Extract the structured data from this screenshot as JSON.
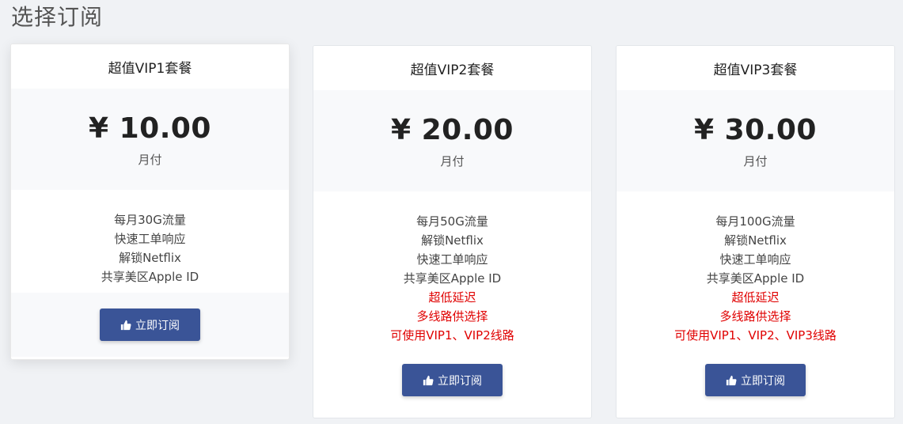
{
  "page": {
    "title": "选择订阅"
  },
  "plans": [
    {
      "name": "超值VIP1套餐",
      "price": "¥ 10.00",
      "period": "月付",
      "features": [
        "每月30G流量",
        "快速工单响应",
        "解锁Netflix",
        "共享美区Apple ID"
      ],
      "highlights": [],
      "button_label": "立即订阅",
      "button_icon": "thumbs-up-icon"
    },
    {
      "name": "超值VIP2套餐",
      "price": "¥ 20.00",
      "period": "月付",
      "features": [
        "每月50G流量",
        "解锁Netflix",
        "快速工单响应",
        "共享美区Apple ID"
      ],
      "highlights": [
        "超低延迟",
        "多线路供选择",
        "可使用VIP1、VIP2线路"
      ],
      "button_label": "立即订阅",
      "button_icon": "thumbs-up-icon"
    },
    {
      "name": "超值VIP3套餐",
      "price": "¥ 30.00",
      "period": "月付",
      "features": [
        "每月100G流量",
        "解锁Netflix",
        "快速工单响应",
        "共享美区Apple ID"
      ],
      "highlights": [
        "超低延迟",
        "多线路供选择",
        "可使用VIP1、VIP2、VIP3线路"
      ],
      "button_label": "立即订阅",
      "button_icon": "thumbs-up-icon"
    }
  ],
  "colors": {
    "button": "#3a5497",
    "highlight": "#e00000",
    "background": "#f0f2f5"
  }
}
